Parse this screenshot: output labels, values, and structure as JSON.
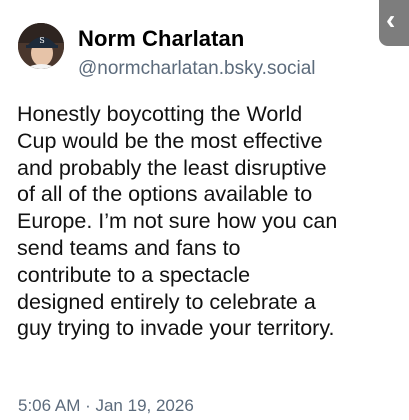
{
  "author": {
    "display_name": "Norm Charlatan",
    "handle": "@normcharlatan.bsky.social",
    "avatar_icon": "avatar-photo-icon"
  },
  "post": {
    "text": "Honestly boycotting the World\nCup would be the most effective\nand probably the least disruptive\nof all of the options available to\nEurope. I’m not sure how you can\nsend teams and fans to\ncontribute to a spectacle\ndesigned entirely to celebrate a\nguy trying to invade your territory.",
    "timestamp": "5:06 AM · Jan 19, 2026"
  },
  "side_tab": {
    "glyph": "‹",
    "color": "#7d7d7d"
  },
  "colors": {
    "secondary_text": "#5c6b7c",
    "primary_text": "#111111"
  }
}
